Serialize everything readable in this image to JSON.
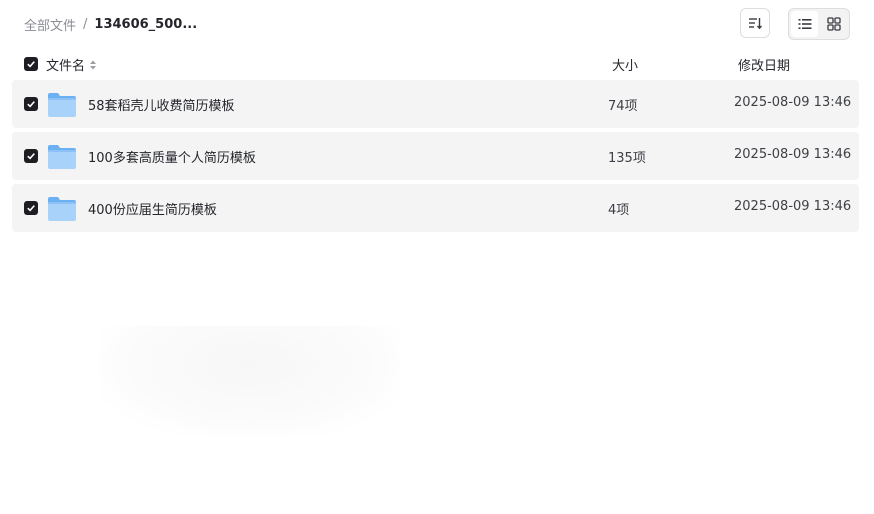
{
  "breadcrumb": {
    "root": "全部文件",
    "separator": "/",
    "current": "134606_500..."
  },
  "toolbar": {
    "sort_icon": "sort-icon",
    "view_modes": [
      {
        "name": "list-view-icon",
        "active": true
      },
      {
        "name": "grid-view-icon",
        "active": false
      }
    ]
  },
  "table": {
    "header": {
      "name": "文件名",
      "size": "大小",
      "date": "修改日期",
      "all_checked": true
    },
    "rows": [
      {
        "name": "58套稻壳儿收费简历模板",
        "size": "74项",
        "date": "2025-08-09 13:46",
        "checked": true,
        "icon": "folder-icon"
      },
      {
        "name": "100多套高质量个人简历模板",
        "size": "135项",
        "date": "2025-08-09 13:46",
        "checked": true,
        "icon": "folder-icon"
      },
      {
        "name": "400份应届生简历模板",
        "size": "4项",
        "date": "2025-08-09 13:46",
        "checked": true,
        "icon": "folder-icon"
      }
    ]
  },
  "colors": {
    "row_background": "#f4f4f5",
    "checkbox": "#1d1e22",
    "folder_light": "#a9d2fb",
    "folder_dark": "#6bb0f1"
  }
}
